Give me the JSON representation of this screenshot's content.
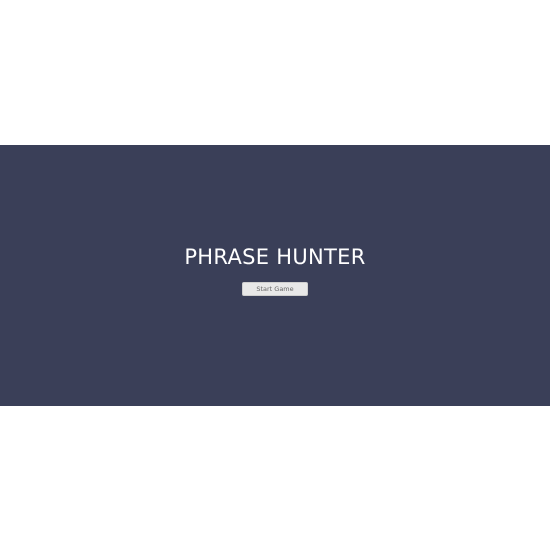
{
  "overlay": {
    "title": "PHRASE HUNTER",
    "start_button_label": "Start Game"
  },
  "colors": {
    "overlay_background": "#3a3f58",
    "page_background": "#ffffff",
    "title_text": "#ffffff",
    "button_background": "#e8e8e8",
    "button_text": "#666666"
  }
}
